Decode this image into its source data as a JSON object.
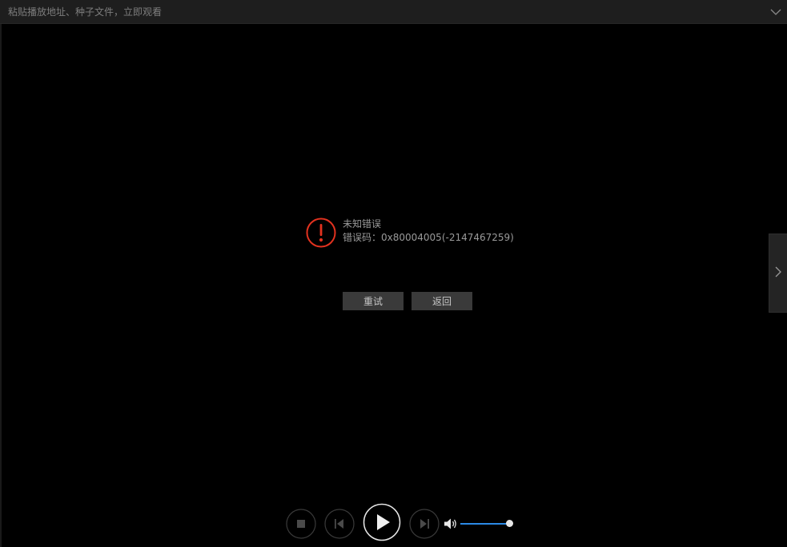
{
  "url_bar": {
    "placeholder": "粘贴播放地址、种子文件，立即观看",
    "dropdown_icon": "chevron-down-icon"
  },
  "error": {
    "icon": "exclamation-circle-icon",
    "icon_color": "#e3321f",
    "title": "未知错误",
    "code_text": "错误码：0x80004005(-2147467259)"
  },
  "buttons": {
    "retry_label": "重试",
    "back_label": "返回"
  },
  "side_panel": {
    "icon": "chevron-right-icon"
  },
  "controls": {
    "stop_icon": "stop-icon",
    "prev_icon": "skip-previous-icon",
    "play_icon": "play-icon",
    "next_icon": "skip-next-icon",
    "volume_icon": "volume-icon",
    "volume_level": 0.93,
    "volume_color": "#2b8ae6"
  }
}
